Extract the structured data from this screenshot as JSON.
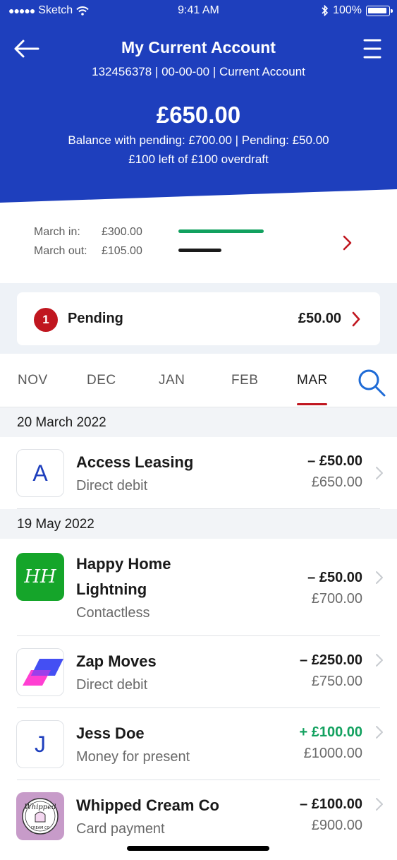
{
  "status_bar": {
    "carrier": "Sketch",
    "time": "9:41 AM",
    "battery": "100%"
  },
  "header": {
    "title": "My Current Account",
    "account_details": "132456378 | 00-00-00 | Current Account",
    "balance": "£650.00",
    "pending_line": "Balance with pending: £700.00 | Pending: £50.00",
    "overdraft_line": "£100 left of £100 overdraft",
    "brand_color": "#1e3fbd"
  },
  "summary": {
    "in_label": "March in:",
    "in_value": "£300.00",
    "out_label": "March out:",
    "out_value": "£105.00",
    "in_color": "#12a15f",
    "out_color": "#1a1a1a"
  },
  "pending": {
    "count": "1",
    "label": "Pending",
    "amount": "£50.00"
  },
  "tabs": [
    {
      "label": "NOV"
    },
    {
      "label": "DEC"
    },
    {
      "label": "JAN"
    },
    {
      "label": "FEB"
    },
    {
      "label": "MAR",
      "active": true
    }
  ],
  "groups": [
    {
      "date": "20 March 2022",
      "transactions": [
        {
          "icon": "letter-a-logo",
          "logo_text": "A",
          "name": "Access Leasing",
          "type": "Direct debit",
          "amount": "– £50.00",
          "balance": "£650.00"
        }
      ]
    },
    {
      "date": "19 May 2022",
      "transactions": [
        {
          "icon": "happy-home-logo",
          "logo_text": "HH",
          "name": "Happy Home Lightning",
          "name_line1": "Happy Home",
          "name_line2": "Lightning",
          "type": "Contactless",
          "amount": "– £50.00",
          "balance": "£700.00"
        },
        {
          "icon": "zap-moves-logo",
          "name": "Zap Moves",
          "type": "Direct debit",
          "amount": "– £250.00",
          "balance": "£750.00"
        },
        {
          "icon": "letter-j-logo",
          "logo_text": "J",
          "name": "Jess Doe",
          "type": "Money for present",
          "amount": "+ £100.00",
          "balance": "£1000.00",
          "credit": true
        },
        {
          "icon": "whipped-cream-logo",
          "logo_text": "Whipped",
          "logo_subtext": "CREAM CO",
          "name": "Whipped Cream Co",
          "type": "Card payment",
          "amount": "– £100.00",
          "balance": "£900.00"
        }
      ]
    }
  ],
  "colors": {
    "accent_red": "#c0161f",
    "credit_green": "#12a15f",
    "link_blue": "#1e6bd6"
  }
}
